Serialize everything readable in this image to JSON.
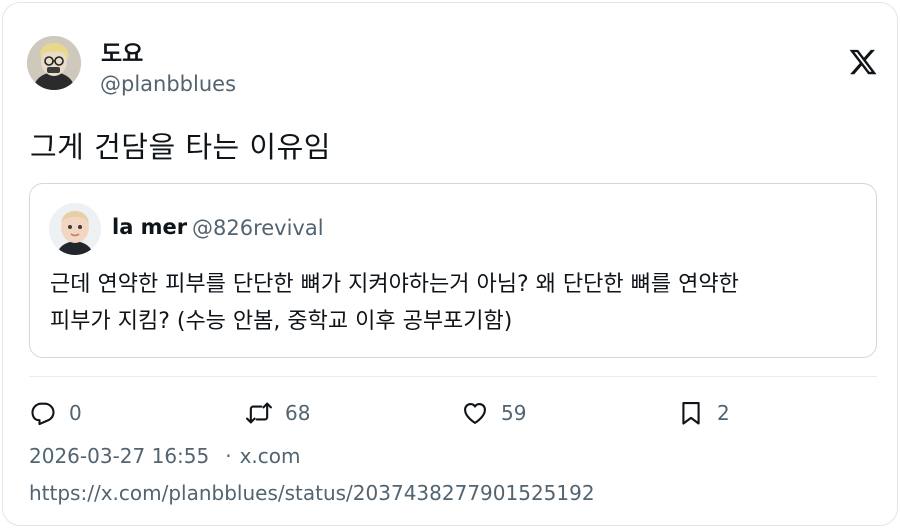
{
  "author": {
    "display_name": "도요",
    "handle": "@planbblues"
  },
  "tweet": {
    "text": "그게 건담을 타는 이유임"
  },
  "quoted": {
    "display_name": "la mer",
    "handle": "@826revival",
    "text": "근데 연약한 피부를 단단한 뼈가 지켜야하는거 아님? 왜 단단한 뼈를 연약한\n피부가 지킴? (수능 안봄, 중학교 이후 공부포기함)"
  },
  "actions": {
    "replies": "0",
    "reposts": "68",
    "likes": "59",
    "bookmarks": "2"
  },
  "meta": {
    "timestamp": "2026-03-27 16:55",
    "separator": "·",
    "site": "x.com",
    "url": "https://x.com/planbblues/status/2037438277901525192"
  },
  "icons": {
    "brand": "x-logo-icon",
    "reply": "reply-icon",
    "repost": "repost-icon",
    "like": "heart-icon",
    "bookmark": "bookmark-icon"
  },
  "colors": {
    "text_primary": "#0f1419",
    "text_secondary": "#536471",
    "border": "#cfd9de"
  }
}
